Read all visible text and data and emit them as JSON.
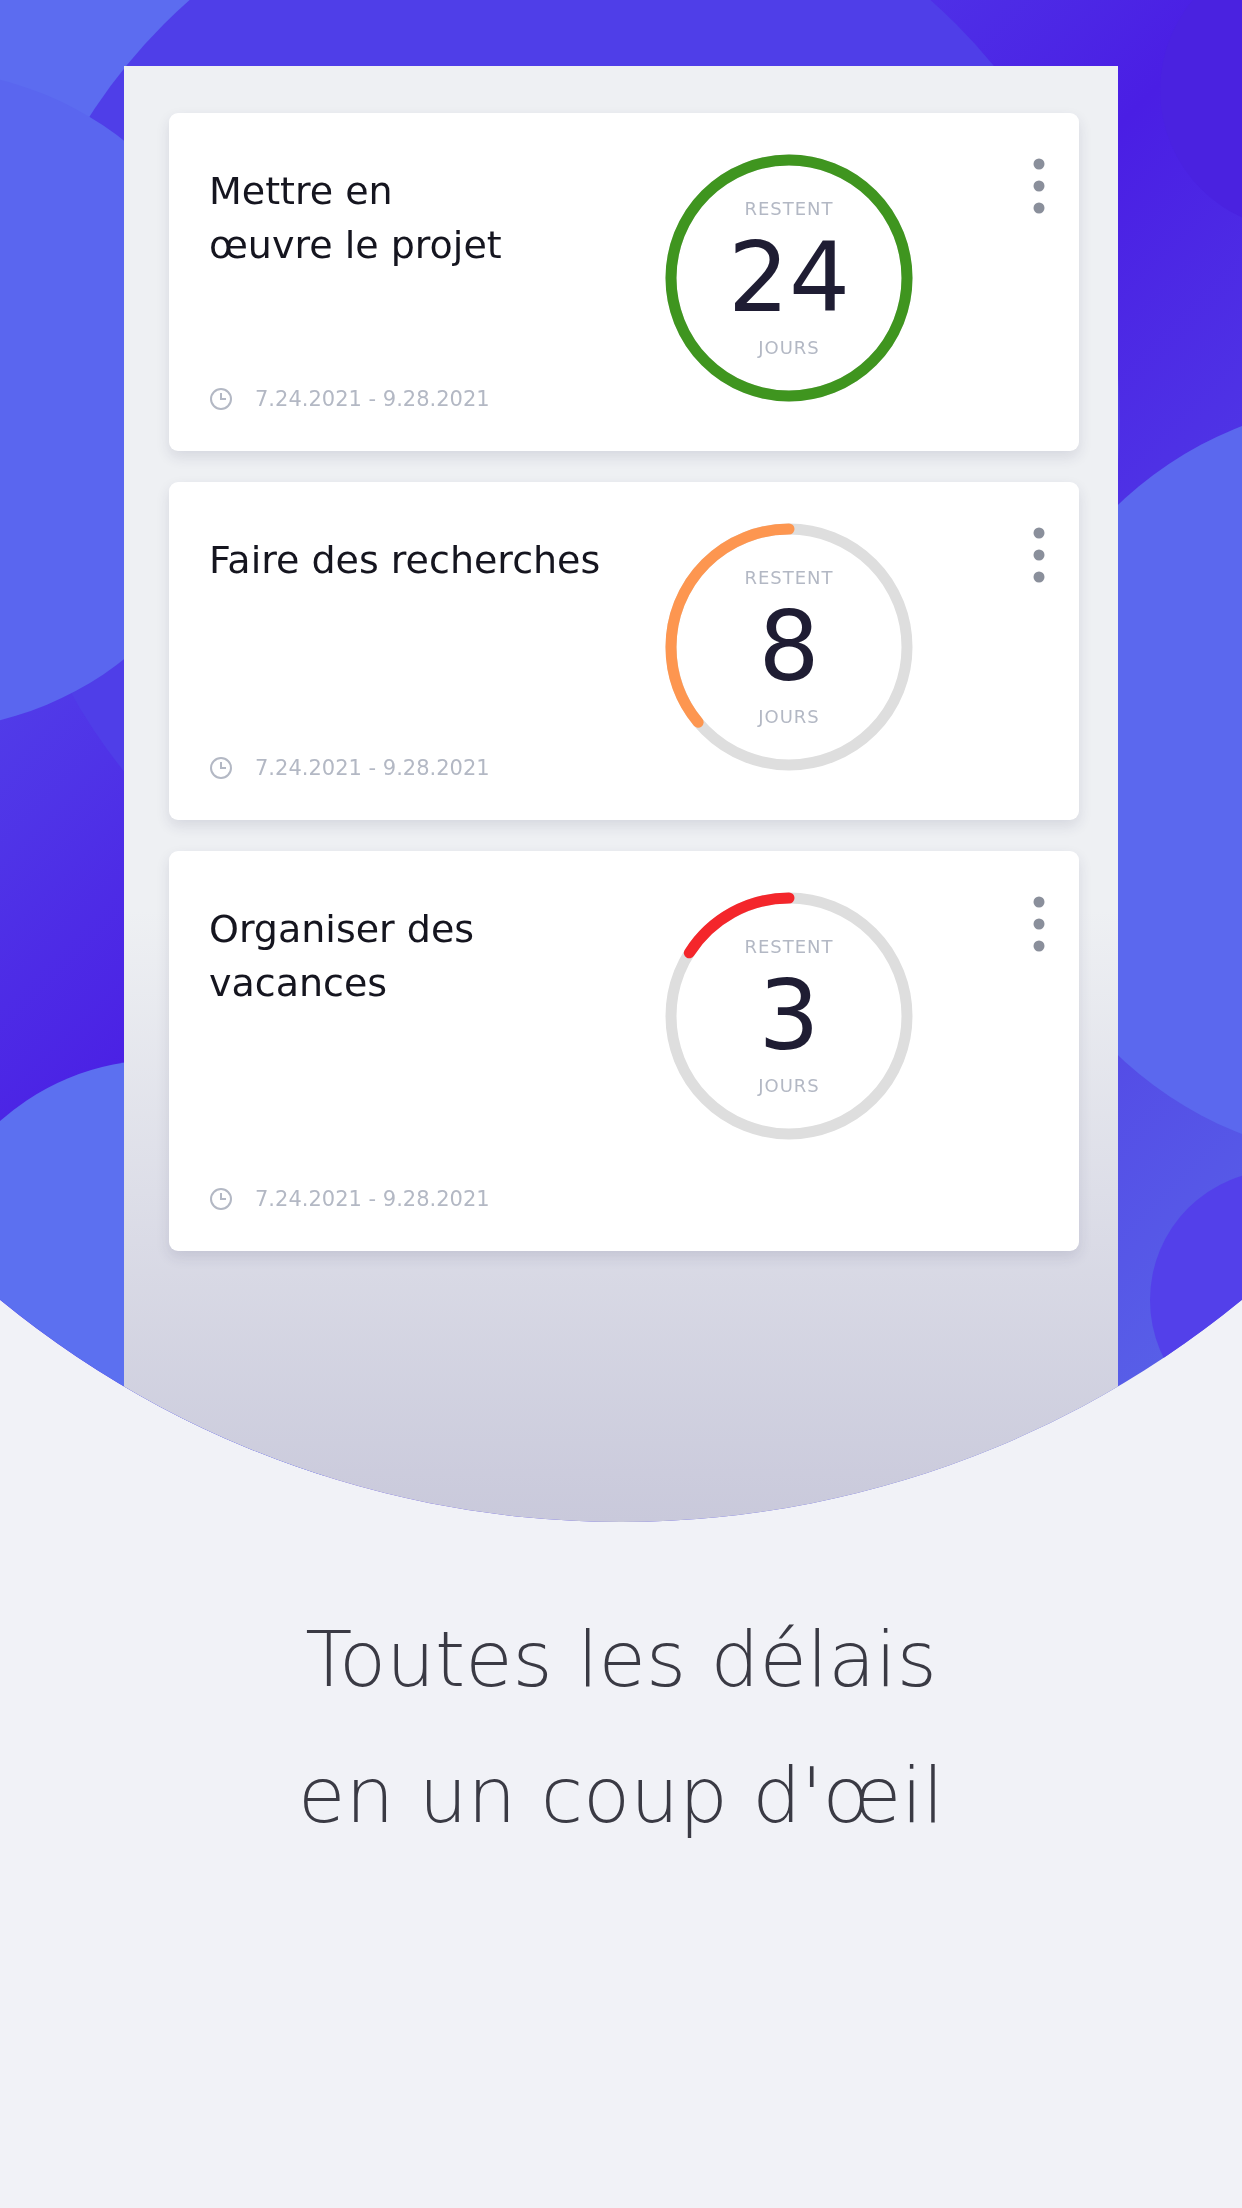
{
  "tasks": [
    {
      "title": "Mettre en\nœuvre le projet",
      "top_label": "RESTENT",
      "days": "24",
      "bottom_label": "JOURS",
      "level": 1,
      "color": "#3f951f",
      "dates": "7.24.2021 - 9.28.2021"
    },
    {
      "title": "Faire des recherches",
      "top_label": "RESTENT",
      "days": "8",
      "bottom_label": "JOURS",
      "level": 0.36,
      "color": "#fd9650",
      "dates": "7.24.2021 - 9.28.2021"
    },
    {
      "title": "Organiser des\nvacances",
      "top_label": "RESTENT",
      "days": "3",
      "bottom_label": "JOURS",
      "level": 0.16,
      "color": "#f4262b",
      "dates": "7.24.2021 - 9.28.2021"
    }
  ],
  "caption": "Toutes les délais\nen un coup d'œil"
}
